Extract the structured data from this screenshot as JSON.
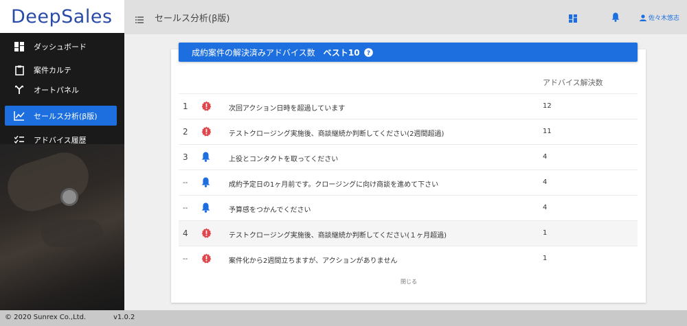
{
  "app": {
    "logo": "DeepSales"
  },
  "sidebar": {
    "items": [
      {
        "label": "ダッシュボード",
        "icon": "dashboard-icon"
      },
      {
        "label": "案件カルテ",
        "icon": "clipboard-icon"
      },
      {
        "label": "オートパネル",
        "icon": "merge-icon"
      },
      {
        "label": "セールス分析(β版)",
        "icon": "trend-chart-icon",
        "active": true
      },
      {
        "label": "アドバイス履歴",
        "icon": "checklist-icon"
      }
    ]
  },
  "topbar": {
    "title": "セールス分析(β版)",
    "user": "佐々木悠志"
  },
  "card": {
    "title": "成約案件の解決済みアドバイス数",
    "best": "ベスト10",
    "column_header": "アドバイス解決数",
    "close_label": "閉じる",
    "rows": [
      {
        "rank": "1",
        "type": "alert",
        "message": "次回アクション日時を超過しています",
        "count": "12"
      },
      {
        "rank": "2",
        "type": "alert",
        "message": "テストクロージング実施後、商談継続か判断してください(2週間超過)",
        "count": "11"
      },
      {
        "rank": "3",
        "type": "bell",
        "message": "上役とコンタクトを取ってください",
        "count": "4"
      },
      {
        "rank": "--",
        "type": "bell",
        "message": "成約予定日の1ヶ月前です。クロージングに向け商談を進めて下さい",
        "count": "4"
      },
      {
        "rank": "--",
        "type": "bell",
        "message": "予算感をつかんでください",
        "count": "4"
      },
      {
        "rank": "4",
        "type": "alert",
        "message": "テストクロージング実施後、商談継続か判断してください(１ヶ月超過)",
        "count": "1"
      },
      {
        "rank": "--",
        "type": "alert",
        "message": "案件化から2週間立ちますが、アクションがありません",
        "count": "1"
      }
    ]
  },
  "footer": {
    "copyright": "© 2020 Sunrex Co.,Ltd.",
    "version": "v1.0.2"
  },
  "colors": {
    "accent": "#1d6fe0",
    "alert": "#e0474c",
    "logo": "#2a4aa8"
  }
}
